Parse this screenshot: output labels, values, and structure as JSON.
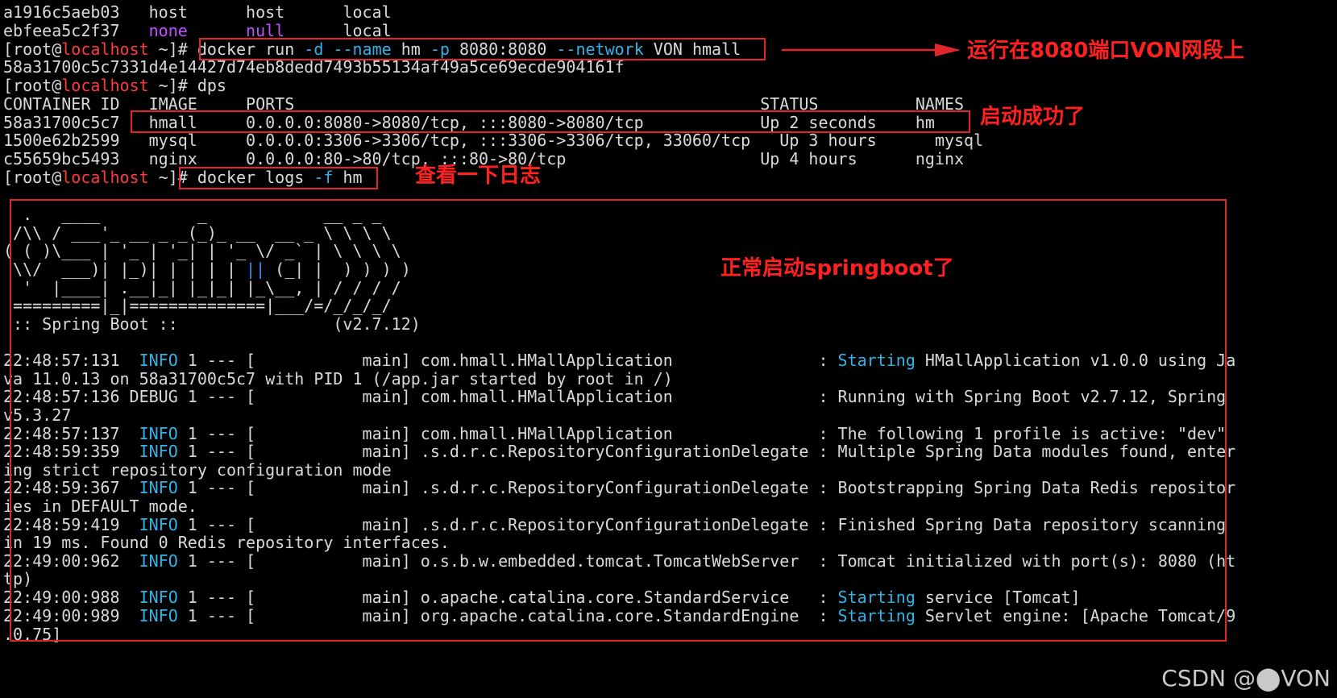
{
  "terminal": {
    "lines": [
      {
        "segments": [
          {
            "t": "a1916c5aeb03   host      host      local",
            "c": "default"
          }
        ]
      },
      {
        "segments": [
          {
            "t": "ebfeea5c2f37   ",
            "c": "default"
          },
          {
            "t": "none",
            "c": "magenta"
          },
          {
            "t": "      ",
            "c": "default"
          },
          {
            "t": "null",
            "c": "magenta"
          },
          {
            "t": "      local",
            "c": "default"
          }
        ]
      },
      {
        "segments": [
          {
            "t": "[root@",
            "c": "default"
          },
          {
            "t": "localhost",
            "c": "red"
          },
          {
            "t": " ~]# docker run ",
            "c": "default"
          },
          {
            "t": "-d --name",
            "c": "cyan"
          },
          {
            "t": " hm ",
            "c": "default"
          },
          {
            "t": "-p",
            "c": "cyan"
          },
          {
            "t": " 8080:8080 ",
            "c": "default"
          },
          {
            "t": "--network",
            "c": "cyan"
          },
          {
            "t": " VON hmall",
            "c": "default"
          }
        ]
      },
      {
        "segments": [
          {
            "t": "58a31700c5c7331d4e14427d74eb8dedd7493b55134af49a5ce69ecde904161f",
            "c": "default"
          }
        ]
      },
      {
        "segments": [
          {
            "t": "[root@",
            "c": "default"
          },
          {
            "t": "localhost",
            "c": "red"
          },
          {
            "t": " ~]# dps",
            "c": "default"
          }
        ]
      },
      {
        "segments": [
          {
            "t": "CONTAINER ID   IMAGE     PORTS                                                STATUS          NAMES",
            "c": "default"
          }
        ]
      },
      {
        "segments": [
          {
            "t": "58a31700c5c7   hmall     0.0.0.0:8080->8080/tcp, :::8080->8080/tcp            Up 2 seconds    hm",
            "c": "default"
          }
        ]
      },
      {
        "segments": [
          {
            "t": "1500e62b2599   mysql     0.0.0.0:3306->3306/tcp, :::3306->3306/tcp, 33060/tcp   Up 3 hours      mysql",
            "c": "default"
          }
        ]
      },
      {
        "segments": [
          {
            "t": "c55659bc5493   nginx     0.0.0.0:80->80/tcp, :::80->80/tcp                    Up 4 hours      nginx",
            "c": "default"
          }
        ]
      },
      {
        "segments": [
          {
            "t": "[root@",
            "c": "default"
          },
          {
            "t": "localhost",
            "c": "red"
          },
          {
            "t": " ~]# docker logs ",
            "c": "default"
          },
          {
            "t": "-f",
            "c": "cyan"
          },
          {
            "t": " hm",
            "c": "default"
          }
        ]
      },
      {
        "segments": [
          {
            "t": "",
            "c": "default"
          }
        ]
      },
      {
        "segments": [
          {
            "t": "  .   ____          _            __ _ _",
            "c": "default"
          }
        ]
      },
      {
        "segments": [
          {
            "t": " /\\\\ / ___'_ __ _ _(_)_ __  __ _ \\ \\ \\ \\",
            "c": "default"
          }
        ]
      },
      {
        "segments": [
          {
            "t": "( ( )\\___ | '_ | '_| | '_ \\/ _` | \\ \\ \\ \\",
            "c": "default"
          }
        ]
      },
      {
        "segments": [
          {
            "t": " \\\\/  ___)| |_)| | | | | ",
            "c": "default"
          },
          {
            "t": "||",
            "c": "blue"
          },
          {
            "t": " (_| |  ) ) ) )",
            "c": "default"
          }
        ]
      },
      {
        "segments": [
          {
            "t": "  '  |____| .__|_| |_|_| |_\\__, | / / / /",
            "c": "default"
          }
        ]
      },
      {
        "segments": [
          {
            "t": " =========|_|==============|___/=/_/_/_/",
            "c": "default"
          }
        ]
      },
      {
        "segments": [
          {
            "t": " :: Spring Boot ::                (v2.7.12)",
            "c": "default"
          }
        ]
      },
      {
        "segments": [
          {
            "t": "",
            "c": "default"
          }
        ]
      },
      {
        "segments": [
          {
            "t": "22:48:57:131  ",
            "c": "default"
          },
          {
            "t": "INFO",
            "c": "cyan"
          },
          {
            "t": " 1 --- [           main] com.hmall.HMallApplication               : ",
            "c": "default"
          },
          {
            "t": "Starting",
            "c": "cyan"
          },
          {
            "t": " HMallApplication v1.0.0 using Ja",
            "c": "default"
          }
        ]
      },
      {
        "segments": [
          {
            "t": "va 11.0.13 on 58a31700c5c7 with PID 1 (/app.jar started by root in /)",
            "c": "default"
          }
        ]
      },
      {
        "segments": [
          {
            "t": "22:48:57:136 DEBUG 1 --- [           main] com.hmall.HMallApplication               : Running with Spring Boot v2.7.12, Spring",
            "c": "default"
          }
        ]
      },
      {
        "segments": [
          {
            "t": "v5.3.27",
            "c": "default"
          }
        ]
      },
      {
        "segments": [
          {
            "t": "22:48:57:137  ",
            "c": "default"
          },
          {
            "t": "INFO",
            "c": "cyan"
          },
          {
            "t": " 1 --- [           main] com.hmall.HMallApplication               : The following 1 profile is active: \"dev\"",
            "c": "default"
          }
        ]
      },
      {
        "segments": [
          {
            "t": "22:48:59:359  ",
            "c": "default"
          },
          {
            "t": "INFO",
            "c": "cyan"
          },
          {
            "t": " 1 --- [           main] .s.d.r.c.RepositoryConfigurationDelegate : Multiple Spring Data modules found, enter",
            "c": "default"
          }
        ]
      },
      {
        "segments": [
          {
            "t": "ing strict repository configuration mode",
            "c": "default"
          }
        ]
      },
      {
        "segments": [
          {
            "t": "22:48:59:367  ",
            "c": "default"
          },
          {
            "t": "INFO",
            "c": "cyan"
          },
          {
            "t": " 1 --- [           main] .s.d.r.c.RepositoryConfigurationDelegate : Bootstrapping Spring Data Redis repositor",
            "c": "default"
          }
        ]
      },
      {
        "segments": [
          {
            "t": "ies in DEFAULT mode.",
            "c": "default"
          }
        ]
      },
      {
        "segments": [
          {
            "t": "22:48:59:419  ",
            "c": "default"
          },
          {
            "t": "INFO",
            "c": "cyan"
          },
          {
            "t": " 1 --- [           main] .s.d.r.c.RepositoryConfigurationDelegate : Finished Spring Data repository scanning",
            "c": "default"
          }
        ]
      },
      {
        "segments": [
          {
            "t": "in 19 ms. Found 0 Redis repository interfaces.",
            "c": "default"
          }
        ]
      },
      {
        "segments": [
          {
            "t": "22:49:00:962  ",
            "c": "default"
          },
          {
            "t": "INFO",
            "c": "cyan"
          },
          {
            "t": " 1 --- [           main] o.s.b.w.embedded.tomcat.TomcatWebServer  : Tomcat initialized with port(s): 8080 (ht",
            "c": "default"
          }
        ]
      },
      {
        "segments": [
          {
            "t": "tp)",
            "c": "default"
          }
        ]
      },
      {
        "segments": [
          {
            "t": "22:49:00:988  ",
            "c": "default"
          },
          {
            "t": "INFO",
            "c": "cyan"
          },
          {
            "t": " 1 --- [           main] o.apache.catalina.core.StandardService   : ",
            "c": "default"
          },
          {
            "t": "Starting",
            "c": "cyan"
          },
          {
            "t": " service [Tomcat]",
            "c": "default"
          }
        ]
      },
      {
        "segments": [
          {
            "t": "22:49:00:989  ",
            "c": "default"
          },
          {
            "t": "INFO",
            "c": "cyan"
          },
          {
            "t": " 1 --- [           main] org.apache.catalina.core.StandardEngine  : ",
            "c": "default"
          },
          {
            "t": "Starting",
            "c": "cyan"
          },
          {
            "t": " Servlet engine: [Apache Tomcat/9",
            "c": "default"
          }
        ]
      },
      {
        "segments": [
          {
            "t": ".0.75]",
            "c": "default"
          }
        ]
      }
    ]
  },
  "annotations": {
    "run_note": "运行在8080端口VON网段上",
    "started_note": "启动成功了",
    "logs_note": "查看一下日志",
    "springboot_note": "正常启动springboot了"
  },
  "watermark": "CSDN @⬤VON",
  "colors": {
    "highlight_box": "#e0262a",
    "annotation_text": "#ff2020",
    "prompt_host": "#ff3b3b",
    "flag_cyan": "#2fb4e8",
    "status_magenta": "#c050ff"
  }
}
